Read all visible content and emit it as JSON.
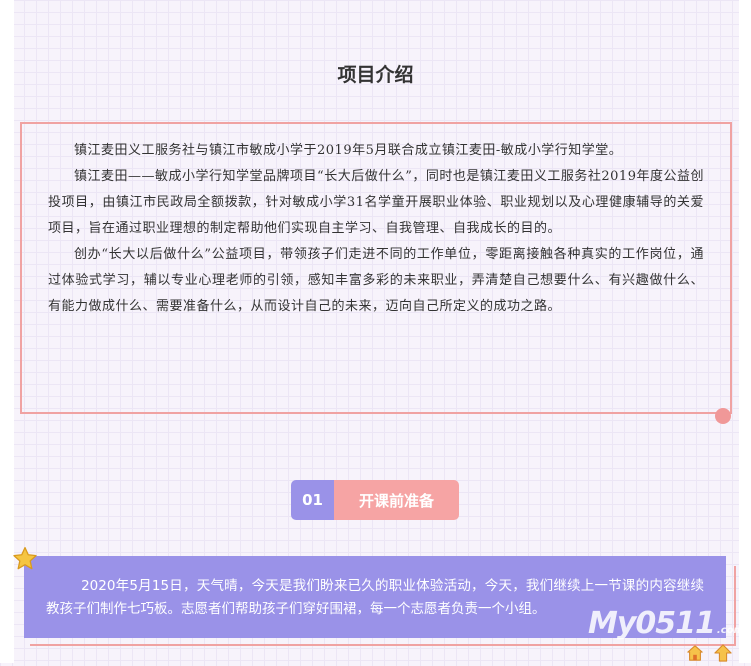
{
  "page_title": "项目介绍",
  "intro": {
    "paragraphs": [
      "镇江麦田义工服务社与镇江市敏成小学于2019年5月联合成立镇江麦田-敏成小学行知学堂。",
      "镇江麦田——敏成小学行知学堂品牌项目“长大后做什么”，同时也是镇江麦田义工服务社2019年度公益创投项目，由镇江市民政局全额拨款，针对敏成小学31名学童开展职业体验、职业规划以及心理健康辅导的关爱项目，旨在通过职业理想的制定帮助他们实现自主学习、自我管理、自我成长的目的。",
      "创办“长大以后做什么”公益项目，带领孩子们走进不同的工作单位，零距离接触各种真实的工作岗位，通过体验式学习，辅以专业心理老师的引领，感知丰富多彩的未来职业，弄清楚自己想要什么、有兴趣做什么、有能力做成什么、需要准备什么，从而设计自己的未来，迈向自己所定义的成功之路。"
    ]
  },
  "section": {
    "number": "01",
    "label": "开课前准备"
  },
  "card": {
    "text": "2020年5月15日，天气晴，今天是我们盼来已久的职业体验活动，今天，我们继续上一节课的内容继续教孩子们制作七巧板。志愿者们帮助孩子们穿好围裙，每一个志愿者负责一个小组。"
  },
  "watermark": {
    "main": "My0511",
    "sub": ".com"
  },
  "icons": {
    "star": "star-icon",
    "home": "home-icon",
    "top": "back-to-top-icon"
  },
  "colors": {
    "accent_purple": "#9a92e8",
    "accent_pink": "#f6a4a4",
    "border_pink": "#f0a2a2",
    "star_yellow": "#f5c542"
  }
}
